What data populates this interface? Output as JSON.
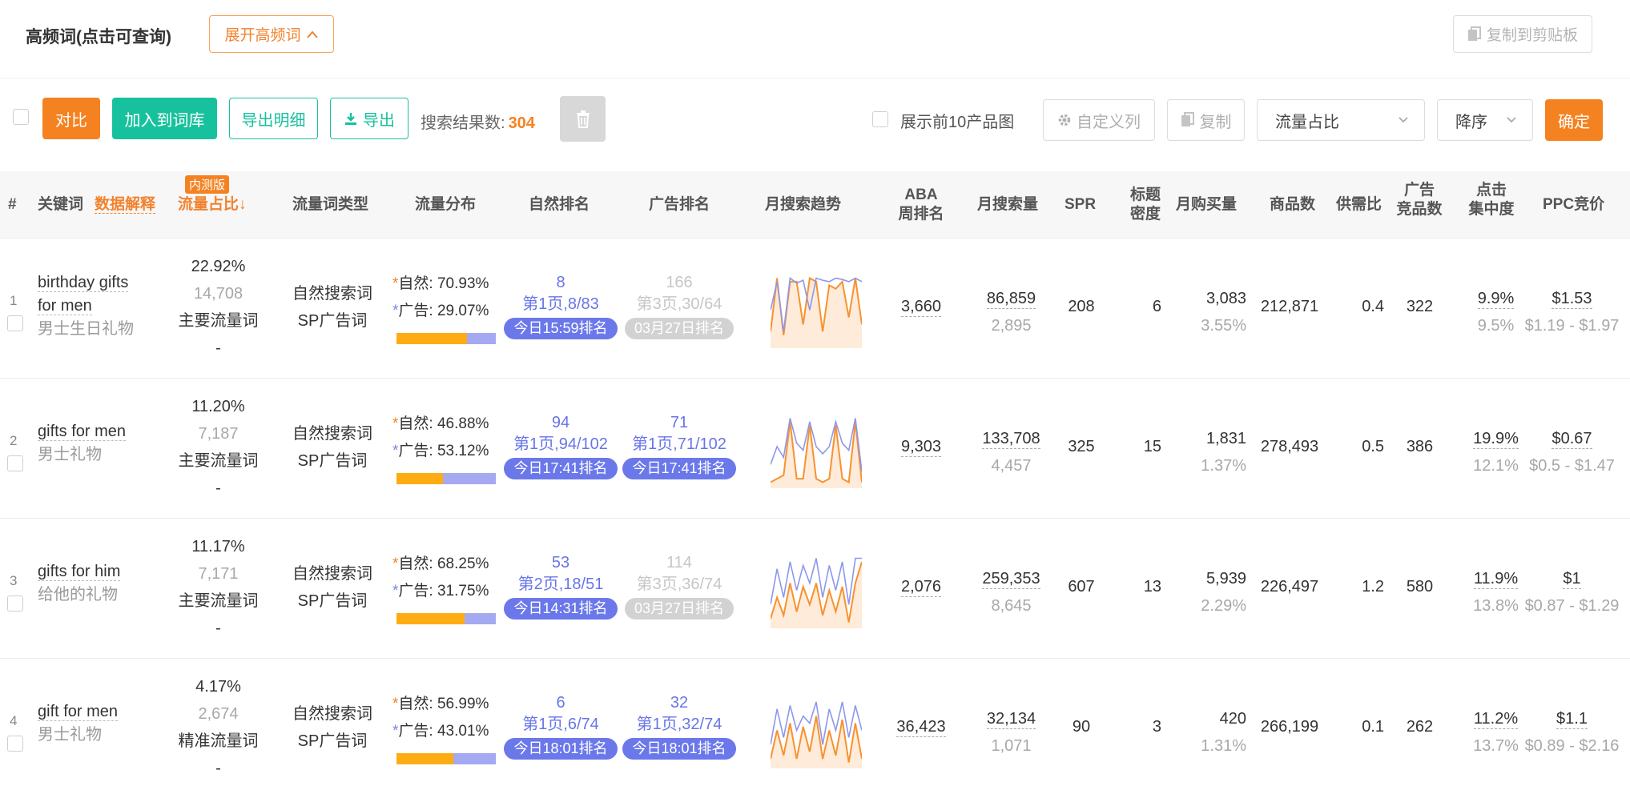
{
  "header": {
    "title": "高频词(点击可查询)",
    "expand_label": "展开高频词",
    "copy_clipboard_label": "复制到剪贴板"
  },
  "toolbar": {
    "compare_label": "对比",
    "add_lib_label": "加入到词库",
    "export_detail_label": "导出明细",
    "export_label": "导出",
    "result_prefix": "搜索结果数:",
    "result_count": "304",
    "show_top_label": "展示前10产品图",
    "custom_col_label": "自定义列",
    "copy_label": "复制",
    "sort_field": "流量占比",
    "sort_order": "降序",
    "confirm_label": "确定"
  },
  "columns": {
    "index": "#",
    "keyword": "关键词",
    "data_explain": "数据解释",
    "beta": "内测版",
    "traffic_share": "流量占比↓",
    "traffic_type": "流量词类型",
    "traffic_dist": "流量分布",
    "natural_rank": "自然排名",
    "ad_rank": "广告排名",
    "monthly_trend": "月搜索趋势",
    "aba_1": "ABA",
    "aba_2": "周排名",
    "monthly_search": "月搜索量",
    "spr": "SPR",
    "title_1": "标题",
    "title_2": "密度",
    "monthly_buy": "月购买量",
    "products": "商品数",
    "supply_demand": "供需比",
    "ad_1": "广告",
    "ad_2": "竞品数",
    "click_1": "点击",
    "click_2": "集中度",
    "ppc": "PPC竞价"
  },
  "labels": {
    "natural": "自然:",
    "ad": "广告:"
  },
  "colors": {
    "accent_orange": "#f58220",
    "accent_green": "#18c19d",
    "rank_blue": "#6b78ea",
    "natural_bar": "#fdad13",
    "ad_bar": "#a4a9f2"
  },
  "rows": [
    {
      "index": "1",
      "kw_en_1": "birthday gifts",
      "kw_en_2": "for men",
      "kw_cn": "男士生日礼物",
      "share": "22.92%",
      "share_count": "14,708",
      "share_type": "主要流量词",
      "share_dash": "-",
      "type_1": "自然搜索词",
      "type_2": "SP广告词",
      "natural_pct": "70.93%",
      "ad_pct": "29.07%",
      "natural_frac": 0.7093,
      "nat_rank": "8",
      "nat_page": "第1页,8/83",
      "nat_time": "今日15:59排名",
      "nat_style": "blue",
      "ad_rank": "166",
      "ad_page": "第3页,30/64",
      "ad_time": "03月27日排名",
      "ad_style": "light",
      "trend_orange": [
        0.2,
        0.95,
        0.15,
        0.9,
        0.9,
        0.3,
        0.95,
        0.9,
        0.2,
        0.85,
        0.8,
        0.9,
        0.4,
        0.95,
        0.3
      ],
      "trend_blue": [
        0.5,
        0.9,
        0.2,
        0.95,
        0.88,
        0.92,
        0.5,
        0.95,
        0.92,
        0.9,
        0.95,
        0.93,
        0.9,
        0.95,
        0.9
      ],
      "aba": "3,660",
      "search": "86,859",
      "search_sub": "2,895",
      "spr": "208",
      "density": "6",
      "buy": "3,083",
      "buy_pct": "3.55%",
      "products": "212,871",
      "ratio": "0.4",
      "ad_count": "322",
      "click": "9.9%",
      "click_sub": "9.5%",
      "ppc": "$1.53",
      "ppc_range": "$1.19 - $1.97"
    },
    {
      "index": "2",
      "kw_en_1": "gifts for men",
      "kw_en_2": "",
      "kw_cn": "男士礼物",
      "share": "11.20%",
      "share_count": "7,187",
      "share_type": "主要流量词",
      "share_dash": "-",
      "type_1": "自然搜索词",
      "type_2": "SP广告词",
      "natural_pct": "46.88%",
      "ad_pct": "53.12%",
      "natural_frac": 0.4688,
      "nat_rank": "94",
      "nat_page": "第1页,94/102",
      "nat_time": "今日17:41排名",
      "nat_style": "blue",
      "ad_rank": "71",
      "ad_page": "第1页,71/102",
      "ad_time": "今日17:41排名",
      "ad_style": "blue",
      "trend_orange": [
        0.05,
        0.1,
        0.15,
        0.9,
        0.1,
        0.1,
        0.85,
        0.1,
        0.05,
        0.1,
        0.85,
        0.1,
        0.05,
        0.9,
        0.05
      ],
      "trend_blue": [
        0.3,
        0.55,
        0.4,
        0.95,
        0.6,
        0.5,
        0.9,
        0.55,
        0.45,
        0.55,
        0.9,
        0.6,
        0.5,
        0.95,
        0.2
      ],
      "aba": "9,303",
      "search": "133,708",
      "search_sub": "4,457",
      "spr": "325",
      "density": "15",
      "buy": "1,831",
      "buy_pct": "1.37%",
      "products": "278,493",
      "ratio": "0.5",
      "ad_count": "386",
      "click": "19.9%",
      "click_sub": "12.1%",
      "ppc": "$0.67",
      "ppc_range": "$0.5 - $1.47"
    },
    {
      "index": "3",
      "kw_en_1": "gifts for him",
      "kw_en_2": "",
      "kw_cn": "给他的礼物",
      "share": "11.17%",
      "share_count": "7,171",
      "share_type": "主要流量词",
      "share_dash": "-",
      "type_1": "自然搜索词",
      "type_2": "SP广告词",
      "natural_pct": "68.25%",
      "ad_pct": "31.75%",
      "natural_frac": 0.6825,
      "nat_rank": "53",
      "nat_page": "第2页,18/51",
      "nat_time": "今日14:31排名",
      "nat_style": "blue",
      "ad_rank": "114",
      "ad_page": "第3页,36/74",
      "ad_time": "03月27日排名",
      "ad_style": "light",
      "trend_orange": [
        0.1,
        0.4,
        0.15,
        0.6,
        0.2,
        0.55,
        0.3,
        0.6,
        0.15,
        0.5,
        0.2,
        0.55,
        0.05,
        0.6,
        0.9
      ],
      "trend_blue": [
        0.3,
        0.8,
        0.4,
        0.9,
        0.5,
        0.85,
        0.6,
        0.95,
        0.4,
        0.85,
        0.5,
        0.9,
        0.3,
        0.95,
        0.95
      ],
      "aba": "2,076",
      "search": "259,353",
      "search_sub": "8,645",
      "spr": "607",
      "density": "13",
      "buy": "5,939",
      "buy_pct": "2.29%",
      "products": "226,497",
      "ratio": "1.2",
      "ad_count": "580",
      "click": "11.9%",
      "click_sub": "13.8%",
      "ppc": "$1",
      "ppc_range": "$0.87 - $1.29"
    },
    {
      "index": "4",
      "kw_en_1": "gift for men",
      "kw_en_2": "",
      "kw_cn": "男士礼物",
      "share": "4.17%",
      "share_count": "2,674",
      "share_type": "精准流量词",
      "share_dash": "-",
      "type_1": "自然搜索词",
      "type_2": "SP广告词",
      "natural_pct": "56.99%",
      "ad_pct": "43.01%",
      "natural_frac": 0.5699,
      "nat_rank": "6",
      "nat_page": "第1页,6/74",
      "nat_time": "今日18:01排名",
      "nat_style": "blue",
      "ad_rank": "32",
      "ad_page": "第1页,32/74",
      "ad_time": "今日18:01排名",
      "ad_style": "blue",
      "trend_orange": [
        0.1,
        0.5,
        0.15,
        0.6,
        0.1,
        0.55,
        0.2,
        0.7,
        0.1,
        0.5,
        0.15,
        0.65,
        0.05,
        0.6,
        0.1
      ],
      "trend_blue": [
        0.3,
        0.8,
        0.4,
        0.85,
        0.5,
        0.7,
        0.6,
        0.9,
        0.3,
        0.8,
        0.5,
        0.9,
        0.4,
        0.85,
        0.5
      ],
      "aba": "36,423",
      "search": "32,134",
      "search_sub": "1,071",
      "spr": "90",
      "density": "3",
      "buy": "420",
      "buy_pct": "1.31%",
      "products": "266,199",
      "ratio": "0.1",
      "ad_count": "262",
      "click": "11.2%",
      "click_sub": "13.7%",
      "ppc": "$1.1",
      "ppc_range": "$0.89 - $2.16"
    }
  ]
}
